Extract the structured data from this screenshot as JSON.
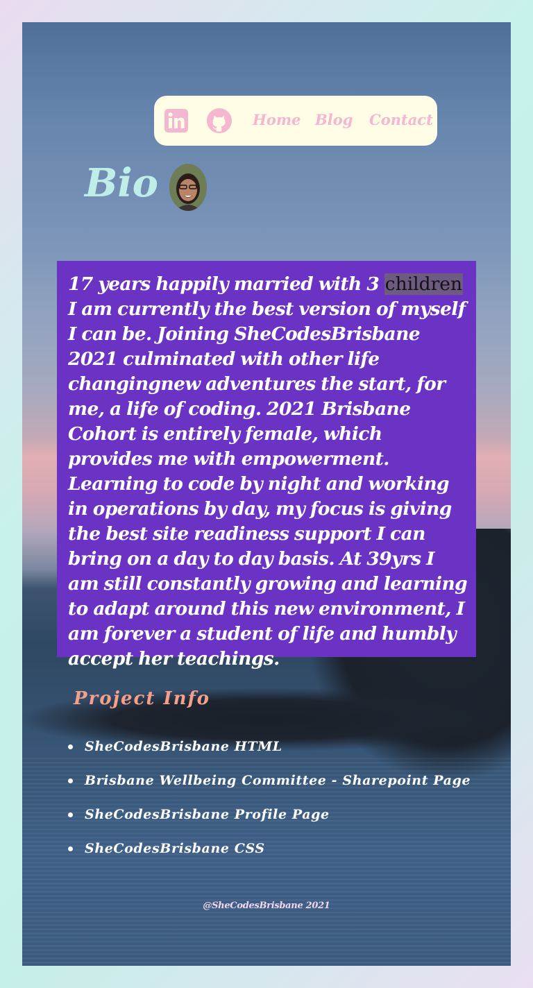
{
  "nav": {
    "icons": [
      "linkedin-icon",
      "github-icon"
    ],
    "links": [
      "Home",
      "Blog",
      "Contact"
    ],
    "icon_color": "#f5b6d0",
    "background": "#fffde6"
  },
  "bio": {
    "title": "Bio",
    "text_before": "17 years happily married with 3 ",
    "highlight": "children",
    "text_after": " I am currently the best version of myself I can be. Joining SheCodesBrisbane 2021 culminated with other life changingnew adventures the start, for me, a life of coding. 2021 Brisbane Cohort is entirely female, which provides me with empowerment. Learning to code by night and working in operations by day, my focus is giving the best site readiness support I can bring on a day to day basis. At 39yrs I am still constantly growing and learning to adapt around this new environment, I am forever a student of life and humbly accept her teachings.",
    "box_color": "#6a33c3"
  },
  "projects": {
    "title": "Project Info",
    "items": [
      "SheCodesBrisbane HTML",
      "Brisbane Wellbeing Committee - Sharepoint Page",
      "SheCodesBrisbane Profile Page",
      "SheCodesBrisbane CSS"
    ]
  },
  "footer": {
    "text": "@SheCodesBrisbane 2021"
  }
}
